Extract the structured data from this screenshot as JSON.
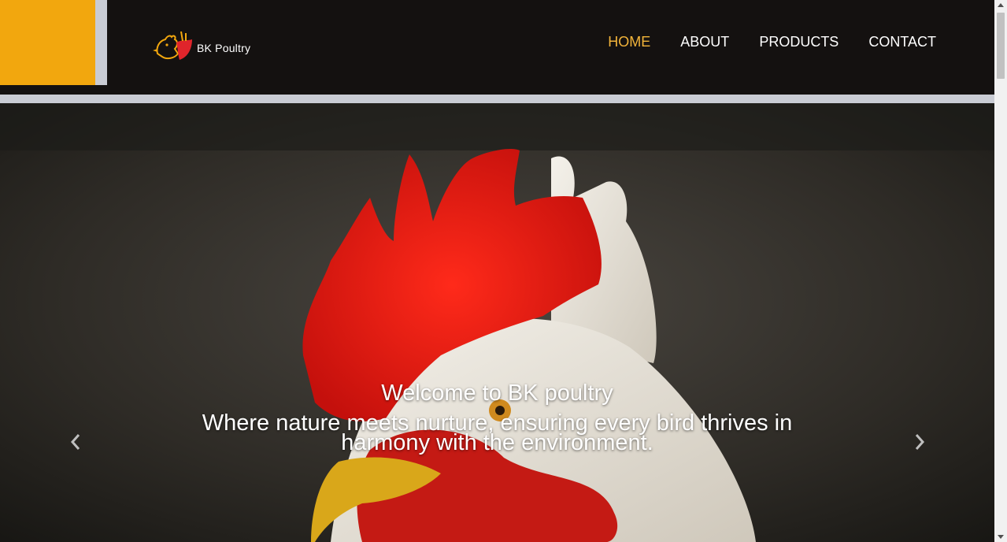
{
  "brand": {
    "name": "BK Poultry",
    "logo_icon": "rooster-icon"
  },
  "nav": {
    "items": [
      {
        "label": "HOME",
        "active": true
      },
      {
        "label": "ABOUT",
        "active": false
      },
      {
        "label": "PRODUCTS",
        "active": false
      },
      {
        "label": "CONTACT",
        "active": false
      }
    ]
  },
  "hero": {
    "title": "Welcome to BK poultry",
    "subtitle": "Where nature meets nurture, ensuring every bird thrives in harmony with the environment.",
    "prev_icon": "chevron-left-icon",
    "next_icon": "chevron-right-icon"
  },
  "colors": {
    "header_bg": "#141110",
    "accent_yellow": "#f2a70e",
    "active_nav": "#f2b43a",
    "divider": "#c9ccd4"
  }
}
